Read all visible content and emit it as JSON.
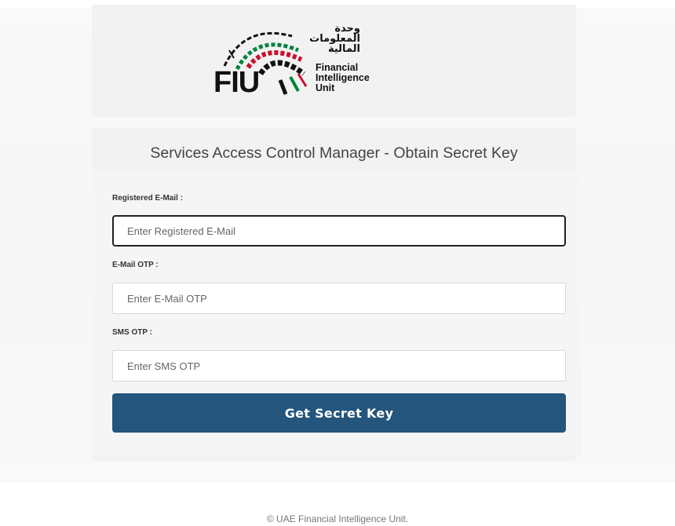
{
  "logo": {
    "abbrev": "FIU",
    "arabic_lines": [
      "وحدة",
      "المعلومات",
      "المالية"
    ],
    "english_lines": [
      "Financial",
      "Intelligence",
      "Unit"
    ],
    "colors": {
      "red": "#c8102e",
      "green": "#00843d",
      "black": "#111111"
    }
  },
  "form": {
    "title": "Services Access Control Manager - Obtain Secret Key",
    "fields": [
      {
        "label": "Registered E-Mail :",
        "placeholder": "Enter Registered E-Mail",
        "value": ""
      },
      {
        "label": "E-Mail OTP :",
        "placeholder": "Enter E-Mail OTP",
        "value": ""
      },
      {
        "label": "SMS OTP :",
        "placeholder": "Enter SMS OTP",
        "value": ""
      }
    ],
    "submit_label": "Get Secret Key",
    "button_color": "#24557c"
  },
  "footer": {
    "copyright": "© UAE Financial Intelligence Unit."
  }
}
